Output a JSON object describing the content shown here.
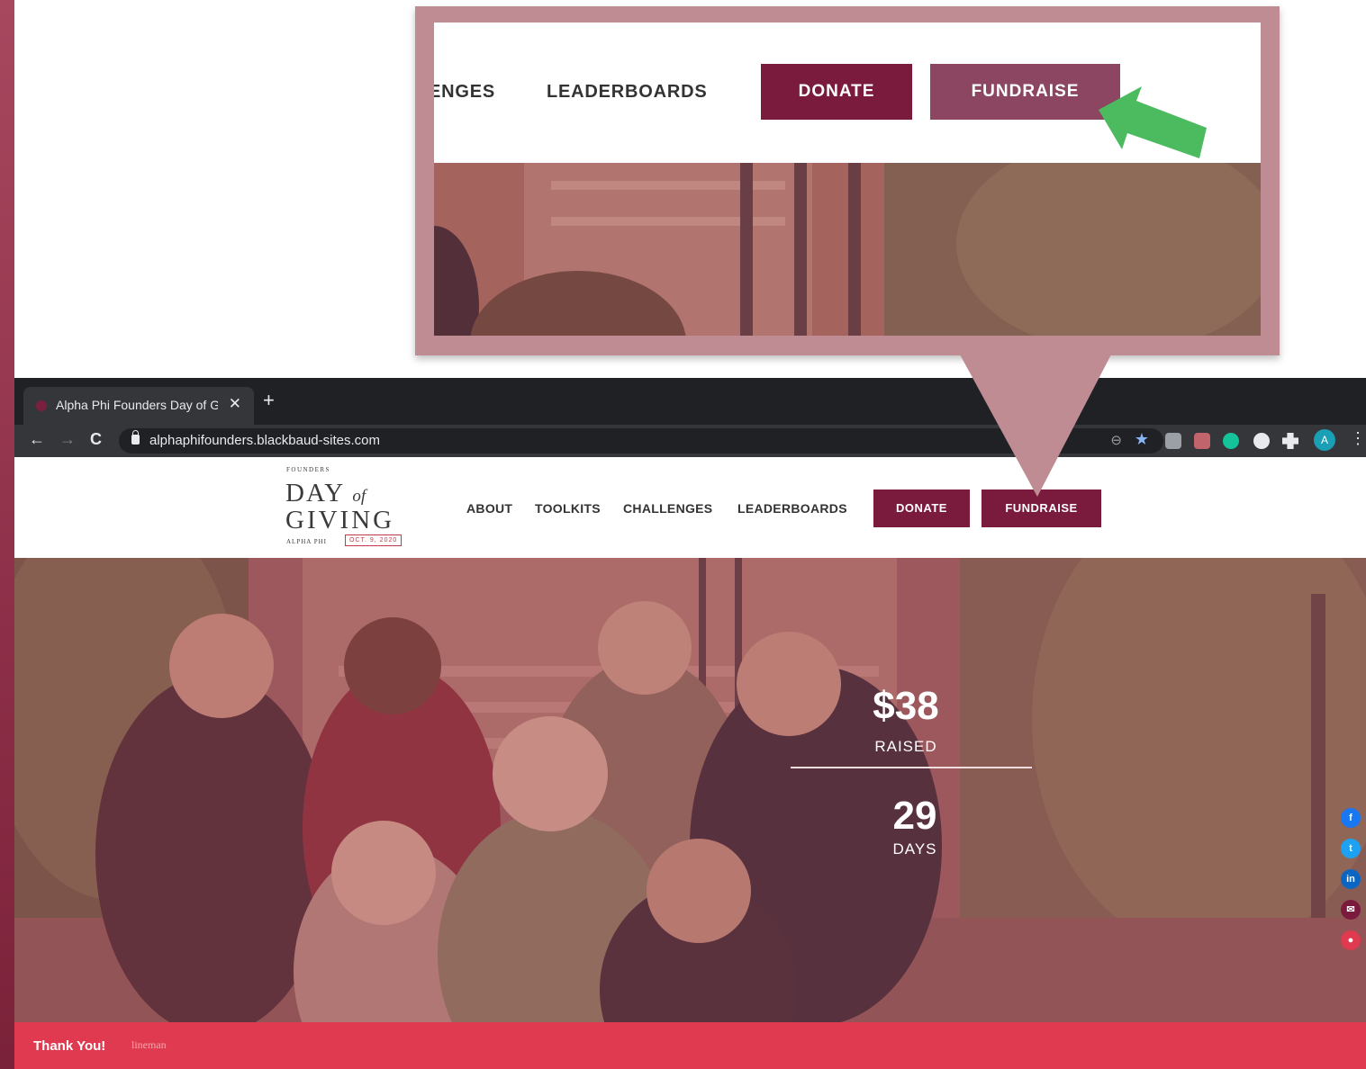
{
  "browser": {
    "tab_title": "Alpha Phi Founders Day of Giving",
    "tab_close": "✕",
    "new_tab": "+",
    "back": "←",
    "forward": "→",
    "reload": "C",
    "url": "alphaphifounders.blackbaud-sites.com",
    "avatar_initial": "A",
    "menu": "⋮"
  },
  "site": {
    "logo": {
      "founders": "FOUNDERS",
      "day": "DAY",
      "of": "of",
      "giving": "GIVING",
      "alpha": "ALPHA PHI",
      "date": "OCT. 9, 2020"
    },
    "nav": [
      "ABOUT",
      "TOOLKITS",
      "CHALLENGES",
      "LEADERBOARDS"
    ],
    "donate": "DONATE",
    "fundraise": "FUNDRAISE"
  },
  "hero": {
    "raised_amount": "$38",
    "raised_label": "RAISED",
    "days_count": "29",
    "days_label": "DAYS"
  },
  "social": [
    "f",
    "t",
    "in",
    "✉",
    "●"
  ],
  "thank_bar": {
    "heading": "Thank You!",
    "name": "lineman"
  },
  "callout": {
    "nav_partial": "ENGES",
    "leaderboards": "LEADERBOARDS",
    "donate": "DONATE",
    "fundraise": "FUNDRAISE"
  },
  "colors": {
    "brand_maroon": "#7a1a3d",
    "callout_frame": "#bf8c93",
    "arrow_green": "#4cbb5f",
    "thank_bar": "#e03a50"
  }
}
